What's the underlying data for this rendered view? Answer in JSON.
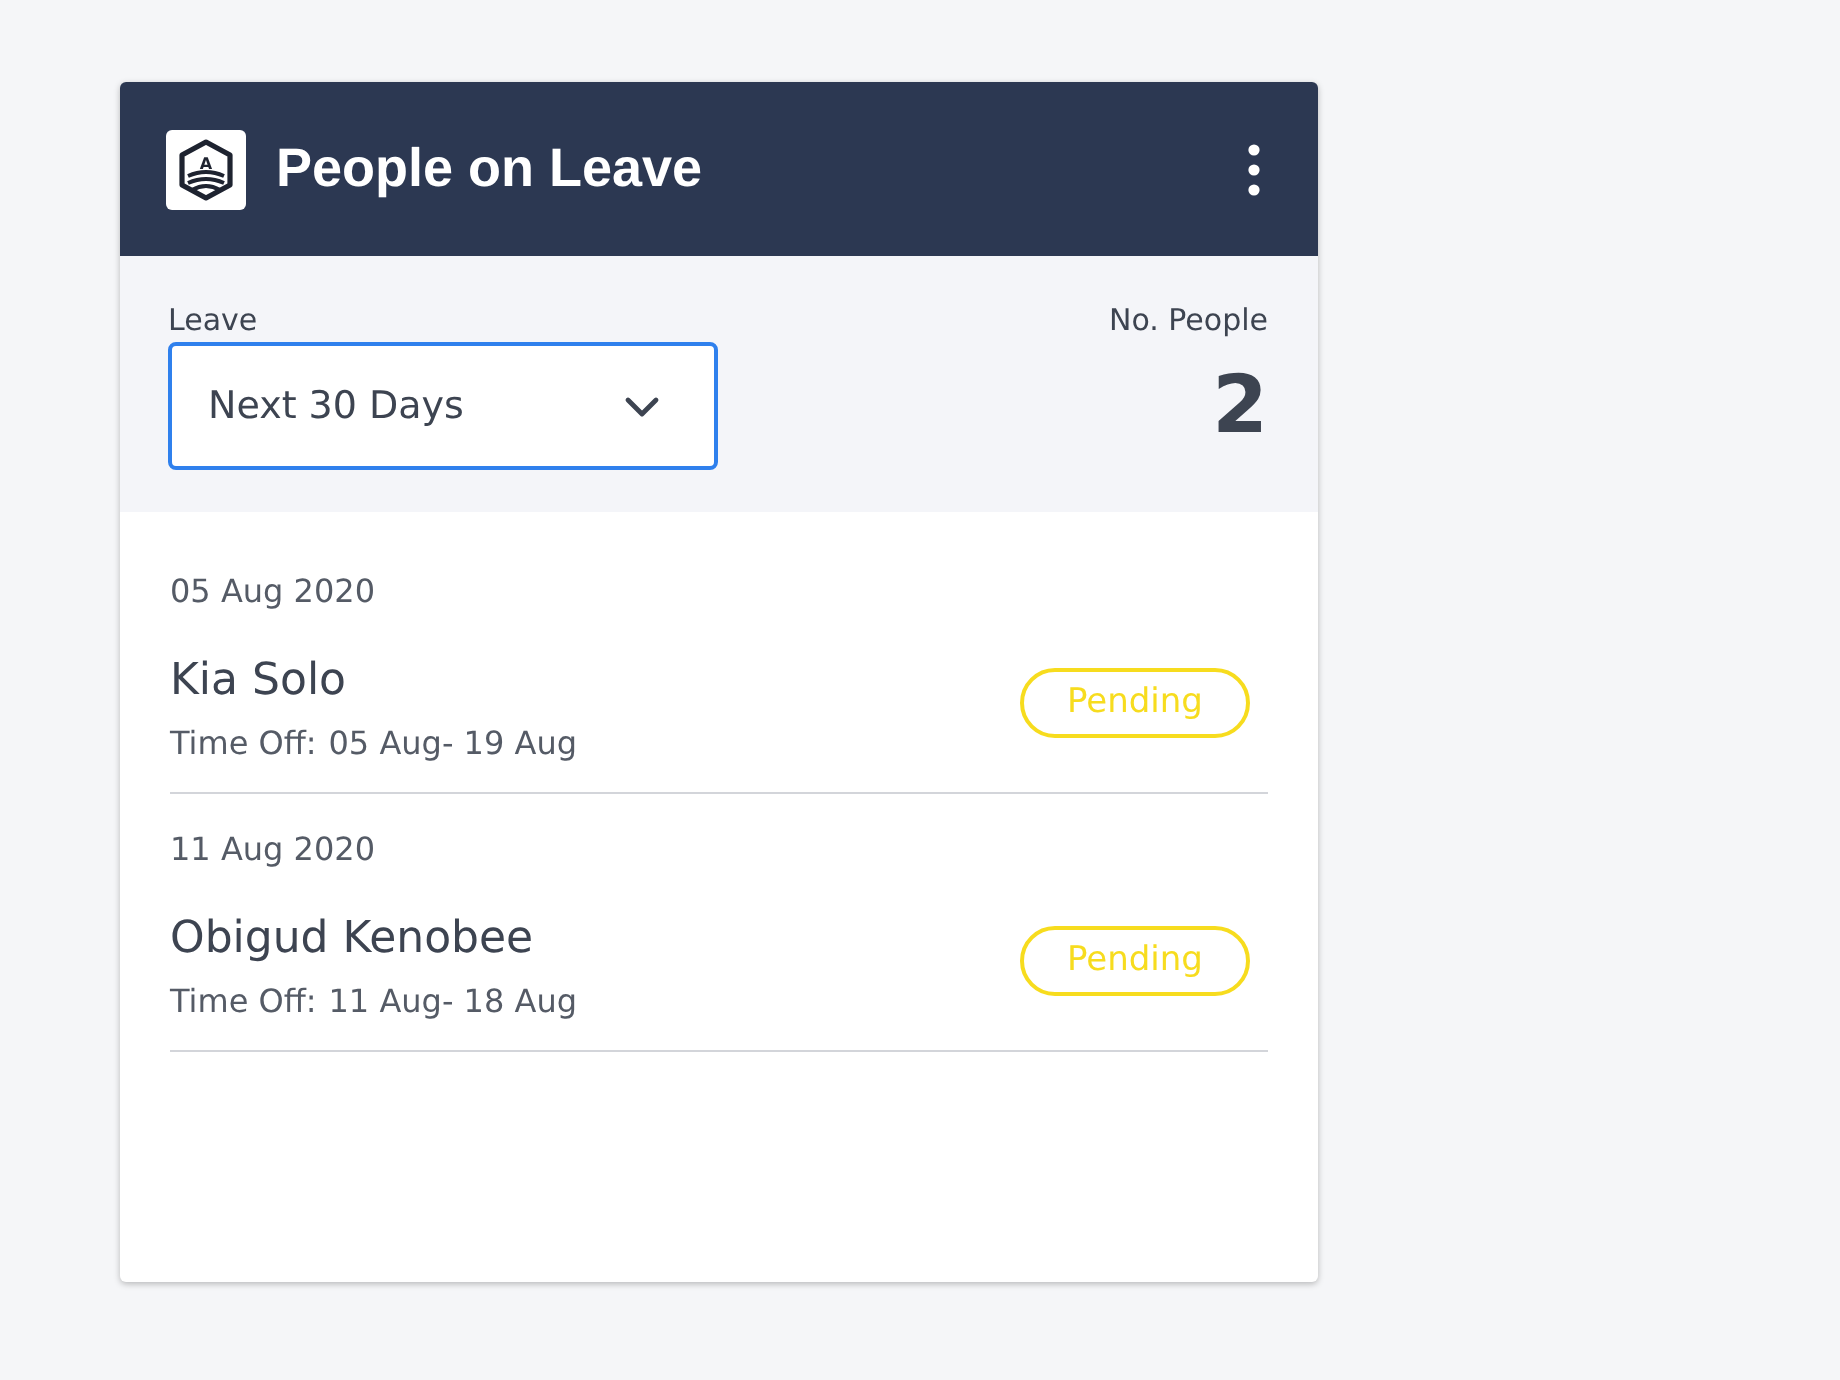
{
  "card": {
    "title": "People on Leave",
    "logo_letter": "A"
  },
  "filter": {
    "label": "Leave",
    "value": "Next 30 Days",
    "focused": true,
    "count_label": "No. People",
    "count": "2"
  },
  "groups": [
    {
      "date": "05 Aug 2020",
      "entries": [
        {
          "name": "Kia Solo",
          "time_off_label": "Time Off:",
          "time_off": "05 Aug- 19 Aug",
          "status": {
            "label": "Pending",
            "color": "#f7dc1e"
          }
        }
      ]
    },
    {
      "date": "11 Aug 2020",
      "entries": [
        {
          "name": "Obigud Kenobee",
          "time_off_label": "Time Off:",
          "time_off": "11 Aug- 18 Aug",
          "status": {
            "label": "Pending",
            "color": "#f7dc1e"
          }
        }
      ]
    }
  ]
}
